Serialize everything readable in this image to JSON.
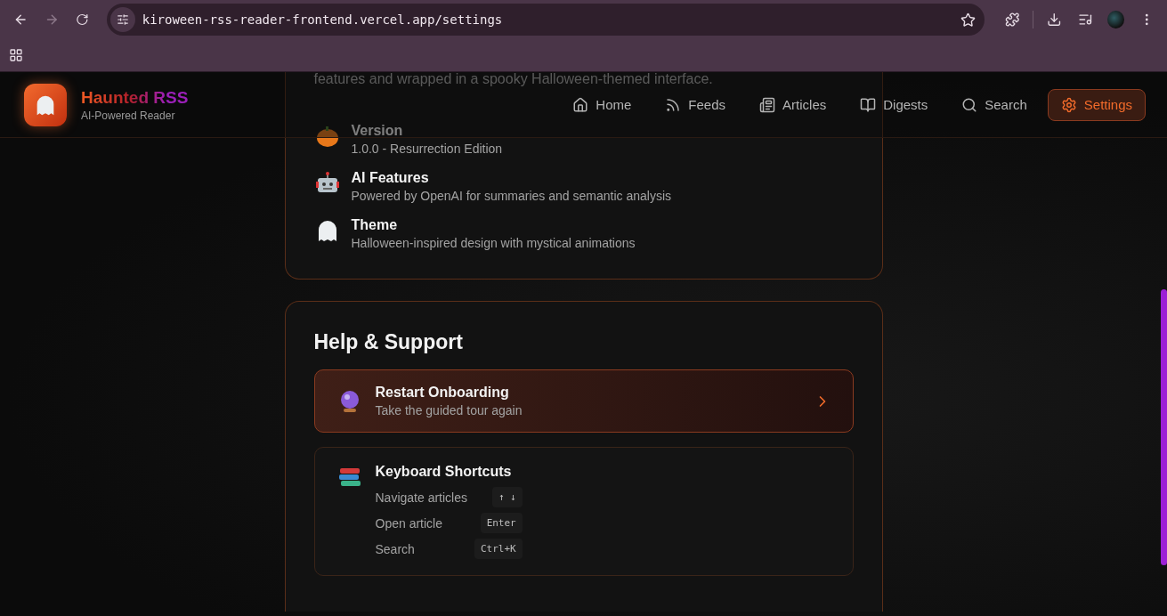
{
  "browser": {
    "url": "kiroween-rss-reader-frontend.vercel.app/settings"
  },
  "header": {
    "brand": "Haunted RSS",
    "tagline": "AI-Powered Reader",
    "nav": [
      {
        "label": "Home",
        "selected": false
      },
      {
        "label": "Feeds",
        "selected": false
      },
      {
        "label": "Articles",
        "selected": false
      },
      {
        "label": "Digests",
        "selected": false
      },
      {
        "label": "Search",
        "selected": false
      },
      {
        "label": "Settings",
        "selected": true
      }
    ]
  },
  "about": {
    "intro": "features and wrapped in a spooky Halloween-themed interface.",
    "items": [
      {
        "title": "Version",
        "text": "1.0.0 - Resurrection Edition"
      },
      {
        "title": "AI Features",
        "text": "Powered by OpenAI for summaries and semantic analysis"
      },
      {
        "title": "Theme",
        "text": "Halloween-inspired design with mystical animations"
      }
    ]
  },
  "help": {
    "title": "Help & Support",
    "onboarding": {
      "title": "Restart Onboarding",
      "subtitle": "Take the guided tour again"
    },
    "shortcuts": {
      "title": "Keyboard Shortcuts",
      "items": [
        {
          "action": "Navigate articles",
          "keys": "↑ ↓"
        },
        {
          "action": "Open article",
          "keys": "Enter"
        },
        {
          "action": "Search",
          "keys": "Ctrl+K"
        }
      ]
    }
  }
}
